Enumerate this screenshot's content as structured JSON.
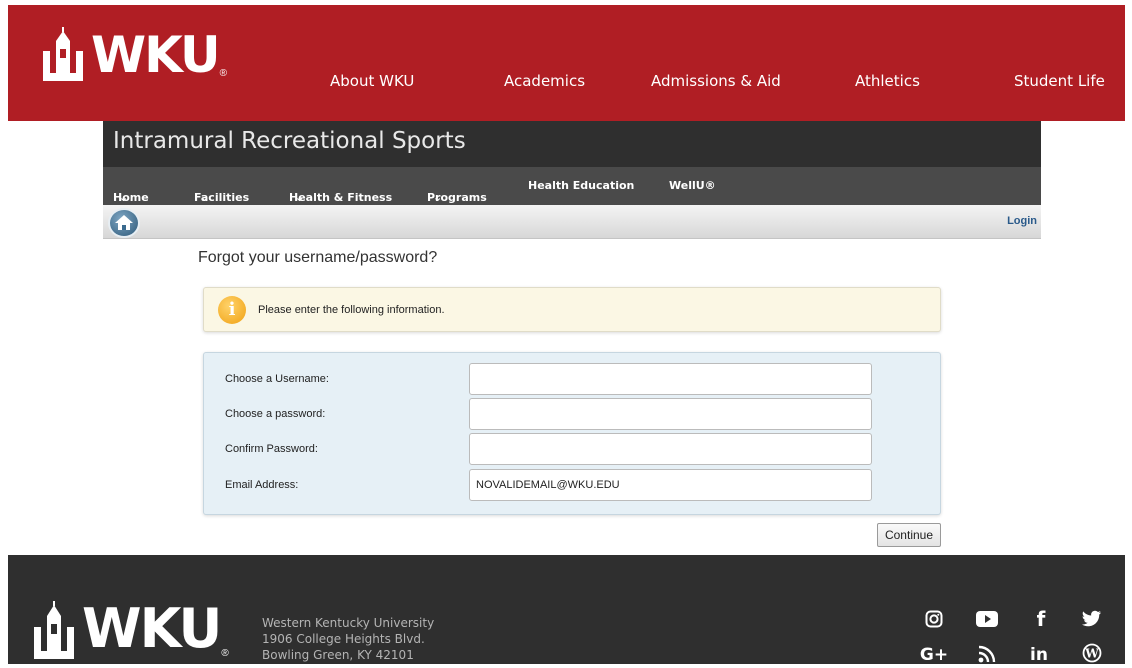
{
  "header": {
    "logo_text": "WKU",
    "logo_mark": "®",
    "nav": [
      "About WKU",
      "Academics",
      "Admissions & Aid",
      "Athletics",
      "Student Life"
    ]
  },
  "site": {
    "title": "Intramural Recreational Sports",
    "subnav": {
      "home": "Home",
      "facilities": "Facilities",
      "health_fitness": "Health & Fitness",
      "programs": "Programs",
      "health_education": "Health Education",
      "wellu": "WellU®"
    },
    "login_label": "Login"
  },
  "page": {
    "heading": "Forgot your username/password?",
    "info_message": "Please enter the following information.",
    "fields": {
      "username_label": "Choose a Username:",
      "username_value": "",
      "password_label": "Choose a password:",
      "password_value": "",
      "confirm_label": "Confirm Password:",
      "confirm_value": "",
      "email_label": "Email Address:",
      "email_value": "NOVALIDEMAIL@WKU.EDU"
    },
    "continue_label": "Continue"
  },
  "footer": {
    "logo_text": "WKU",
    "logo_mark": "®",
    "address_line1": "Western Kentucky University",
    "address_line2": "1906 College Heights Blvd.",
    "address_line3": "Bowling Green, KY 42101",
    "social_icons": [
      "instagram-icon",
      "youtube-icon",
      "facebook-icon",
      "twitter-icon",
      "google-plus-icon",
      "rss-icon",
      "linkedin-icon",
      "wordpress-icon"
    ]
  },
  "colors": {
    "brand_red": "#b01e24",
    "banner_dark": "#2f2f2f",
    "subnav_gray": "#4a4a4a",
    "info_bg": "#fbf7e4",
    "form_bg": "#e6f0f6",
    "link_blue": "#2a5a8a"
  }
}
